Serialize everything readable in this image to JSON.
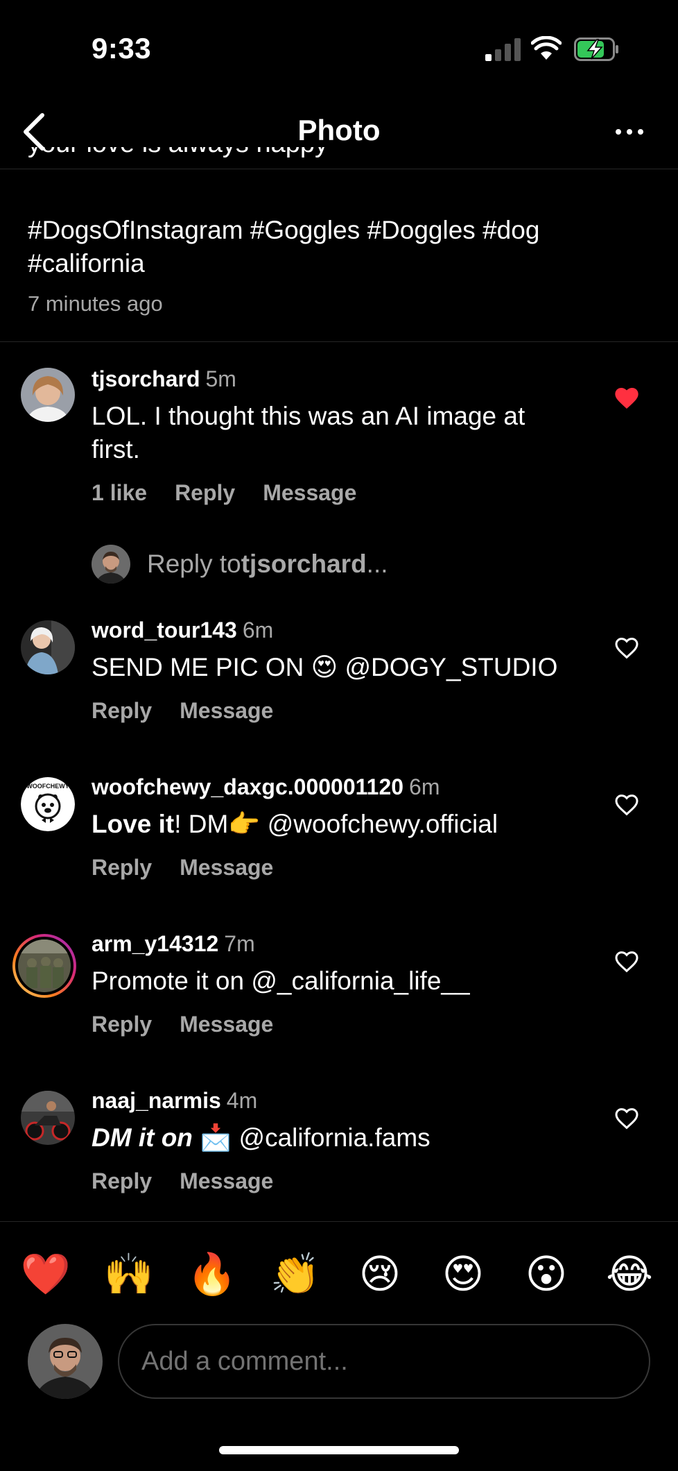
{
  "status_bar": {
    "time": "9:33"
  },
  "header": {
    "title": "Photo"
  },
  "caption": {
    "cut_line": "your love is always happy",
    "hashtags": "#DogsOfInstagram #Goggles #Doggles #dog #california",
    "time": "7 minutes ago"
  },
  "comments": [
    {
      "username": "tjsorchard",
      "age": "5m",
      "text": "LOL. I thought this was an AI image at first.",
      "likes": "1 like",
      "reply": "Reply",
      "message": "Message",
      "liked": true
    },
    {
      "username": "word_tour143",
      "age": "6m",
      "text_a": "SEND ME PIC ON ",
      "emoji": "😍",
      "text_b": " @DOGY_STUDIO",
      "reply": "Reply",
      "message": "Message"
    },
    {
      "username": "woofchewy_daxgc.000001120",
      "age": "6m",
      "bold": "Love it",
      "text_a": "! DM",
      "emoji": "👉",
      "text_b": " @woofchewy.official",
      "reply": "Reply",
      "message": "Message"
    },
    {
      "username": "arm_y14312",
      "age": "7m",
      "text": "Promote it on @_california_life__",
      "reply": "Reply",
      "message": "Message"
    },
    {
      "username": "naaj_narmis",
      "age": "4m",
      "bold_italic": "DM it on",
      "emoji": "📩",
      "text_b": " @california.fams",
      "reply": "Reply",
      "message": "Message"
    }
  ],
  "reply_prompt": {
    "prefix": "Reply to ",
    "username": "tjsorchard",
    "suffix": "..."
  },
  "emoji_bar": [
    "❤️",
    "🙌",
    "🔥",
    "👏",
    "😢",
    "😍",
    "😮",
    "😂"
  ],
  "composer": {
    "placeholder": "Add a comment..."
  },
  "colors": {
    "background": "#000000",
    "secondary_text": "#a8a8a8",
    "like_red": "#ff3040",
    "divider": "#262626"
  }
}
